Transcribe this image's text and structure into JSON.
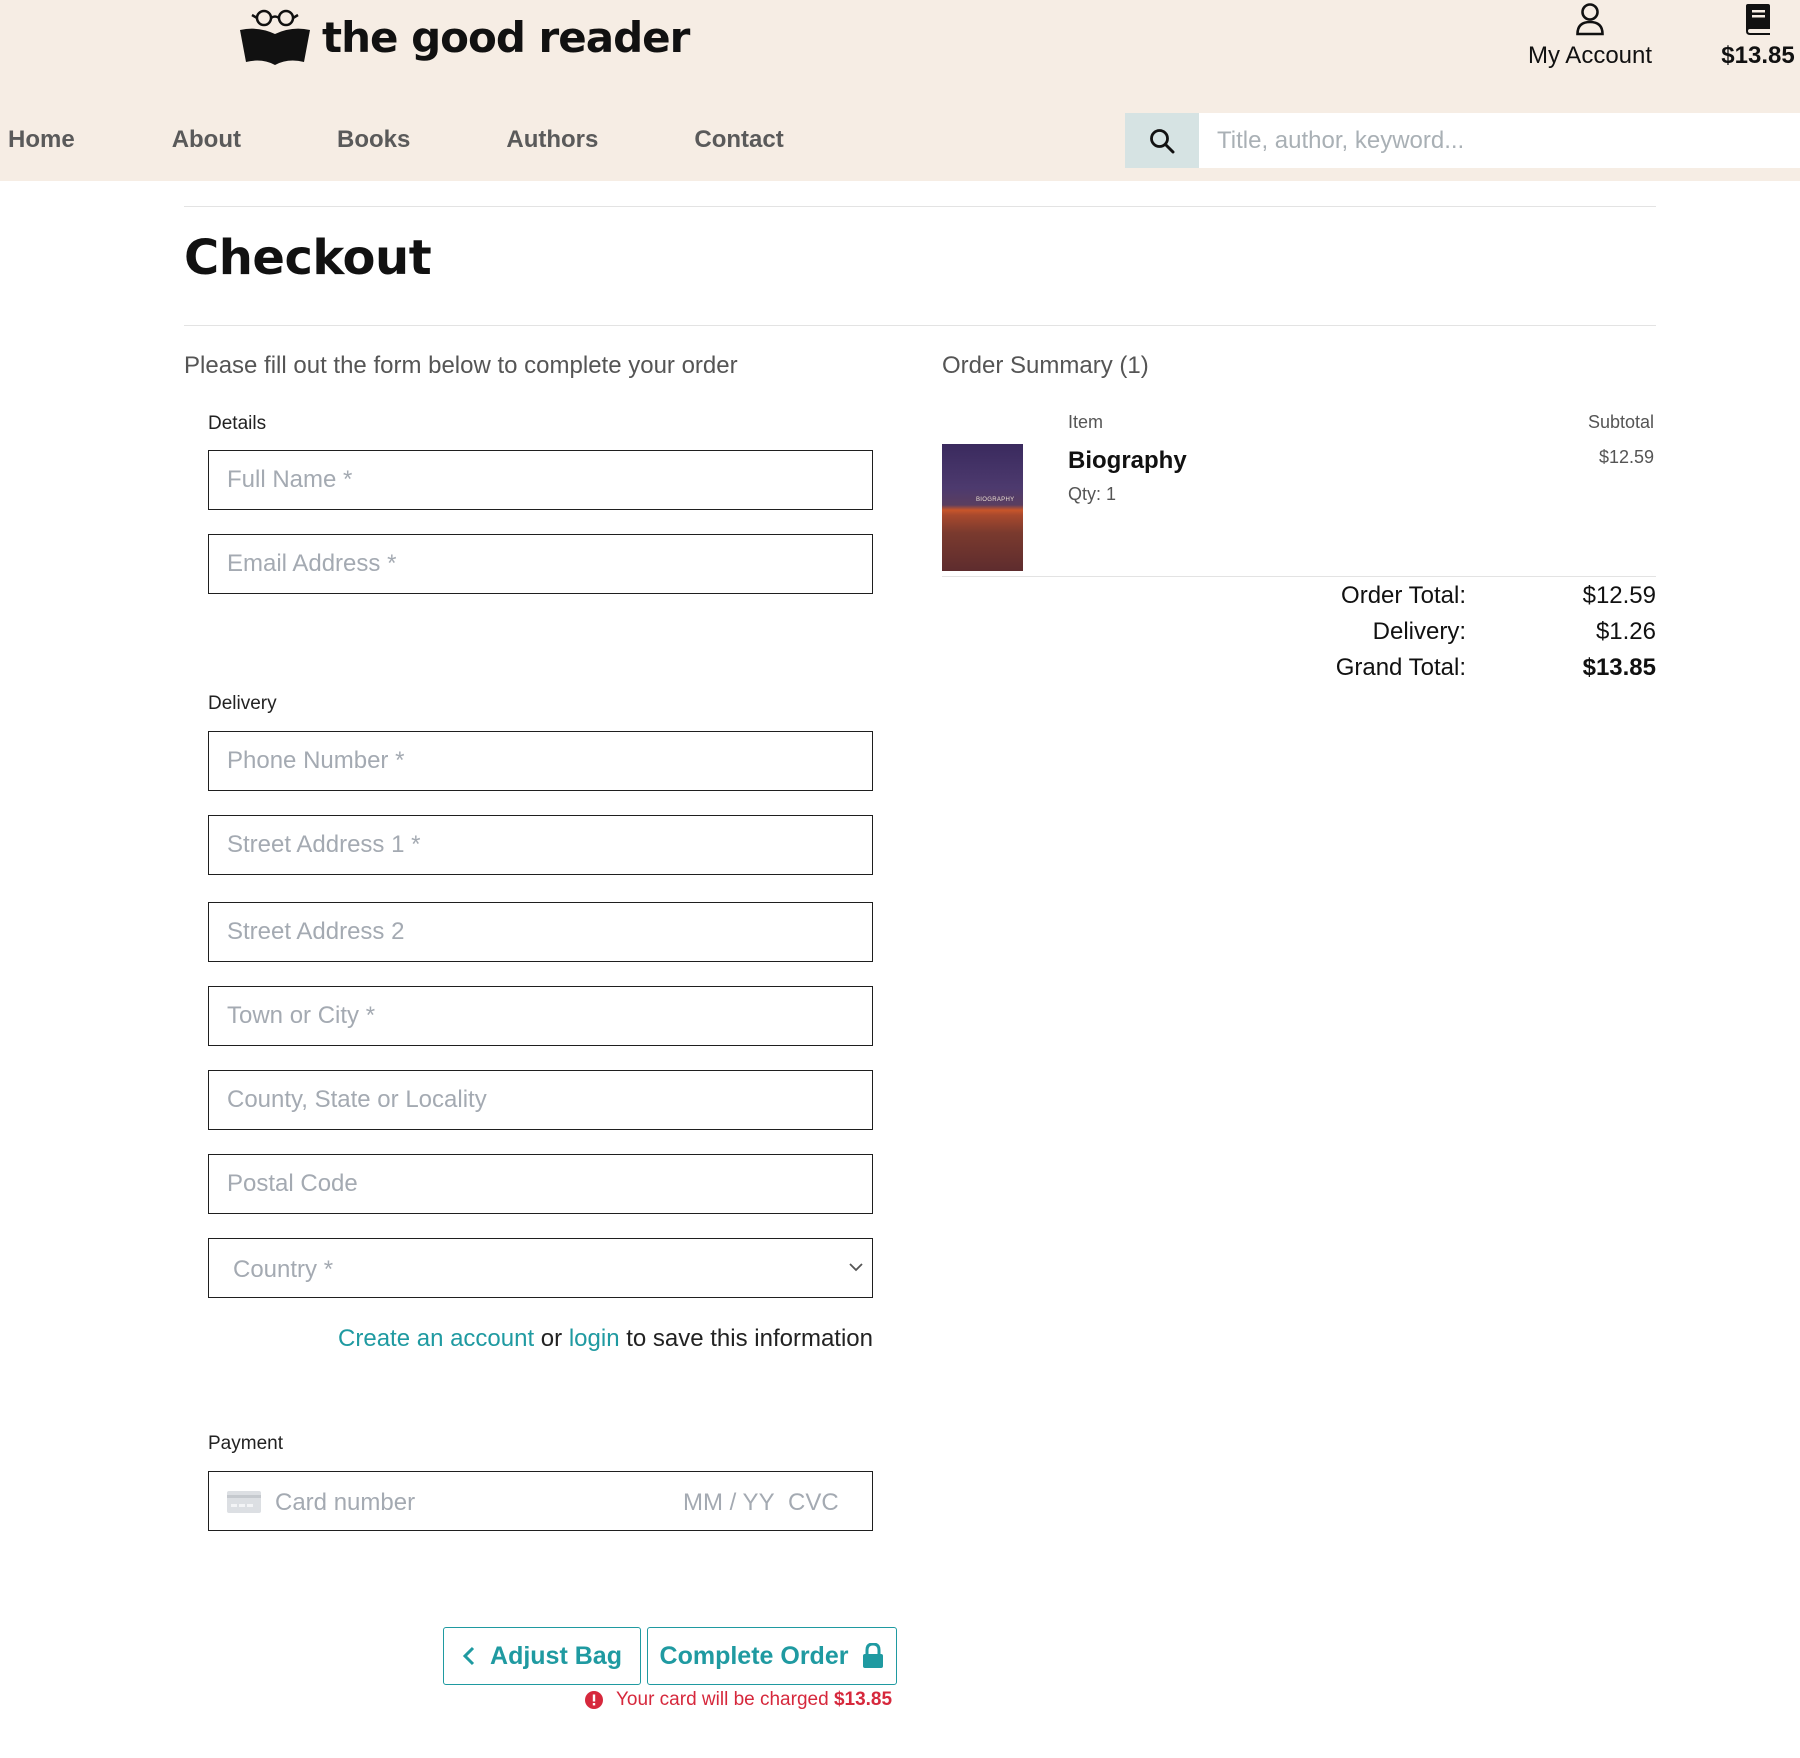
{
  "brand": {
    "name": "the good reader"
  },
  "header": {
    "account_label": "My Account",
    "bag_total": "$13.85"
  },
  "nav": {
    "items": [
      "Home",
      "About",
      "Books",
      "Authors",
      "Contact"
    ]
  },
  "search": {
    "placeholder": "Title, author, keyword..."
  },
  "page": {
    "title": "Checkout",
    "intro": "Please fill out the form below to complete your order"
  },
  "form": {
    "details_label": "Details",
    "full_name_placeholder": "Full Name *",
    "email_placeholder": "Email Address *",
    "delivery_label": "Delivery",
    "phone_placeholder": "Phone Number *",
    "street1_placeholder": "Street Address 1 *",
    "street2_placeholder": "Street Address 2",
    "town_placeholder": "Town or City *",
    "county_placeholder": "County, State or Locality",
    "postal_placeholder": "Postal Code",
    "country_placeholder": "Country *",
    "account_note": {
      "create_link": "Create an account",
      "or_text": " or ",
      "login_link": "login",
      "suffix": " to save this information"
    },
    "payment_label": "Payment",
    "card": {
      "number_placeholder": "Card number",
      "exp_placeholder": "MM / YY",
      "cvc_placeholder": "CVC"
    },
    "adjust_button": "Adjust Bag",
    "complete_button": "Complete Order",
    "charge_note": "Your card will be charged",
    "charge_amount": "$13.85"
  },
  "summary": {
    "title": "Order Summary (1)",
    "col_item": "Item",
    "col_subtotal": "Subtotal",
    "items": [
      {
        "title": "Biography",
        "qty": "Qty: 1",
        "price": "$12.59",
        "cover_text": "BIOGRAPHY"
      }
    ],
    "order_total_label": "Order Total:",
    "order_total": "$12.59",
    "delivery_label": "Delivery:",
    "delivery": "$1.26",
    "grand_total_label": "Grand Total:",
    "grand_total": "$13.85"
  },
  "colors": {
    "header_bg": "#f6ede4",
    "accent": "#1f9aa1",
    "error": "#d6283c",
    "search_button_bg": "#d6e3e3"
  }
}
